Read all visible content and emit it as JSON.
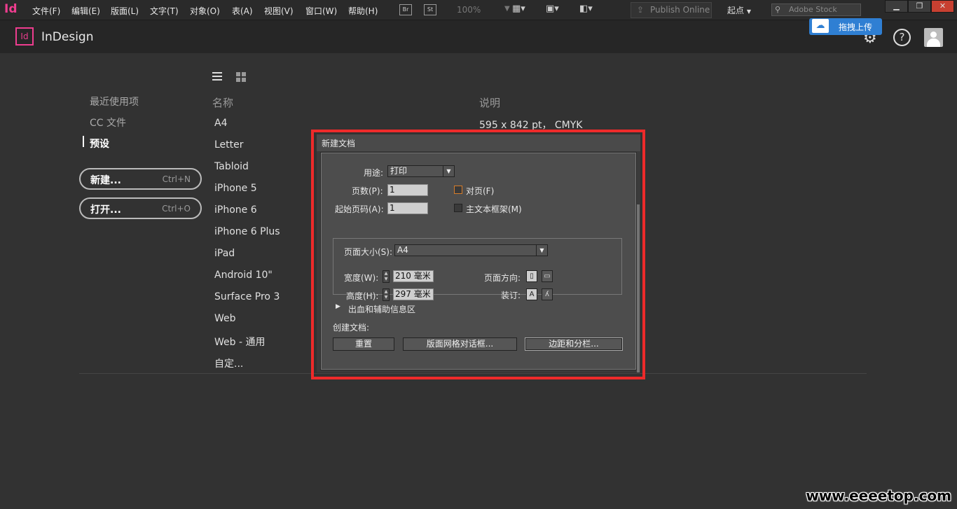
{
  "menubar": {
    "app_icon": "Id",
    "items": [
      "文件(F)",
      "编辑(E)",
      "版面(L)",
      "文字(T)",
      "对象(O)",
      "表(A)",
      "视图(V)",
      "窗口(W)",
      "帮助(H)"
    ],
    "bridge_label": "Br",
    "stock_label": "St",
    "zoom": "100%",
    "publish_online": "Publish Online",
    "workspace": "起点",
    "stock_search_placeholder": "Adobe Stock"
  },
  "header": {
    "logo_text": "Id",
    "app_name": "InDesign",
    "upload_badge": "拖拽上传"
  },
  "nav": {
    "recent": "最近使用项",
    "cc_files": "CC 文件",
    "presets": "预设"
  },
  "actions": {
    "new_label": "新建...",
    "new_shortcut": "Ctrl+N",
    "open_label": "打开...",
    "open_shortcut": "Ctrl+O"
  },
  "list": {
    "name_header": "名称",
    "desc_header": "说明",
    "first_desc": "595 x 842 pt， CMYK",
    "presets": [
      "A4",
      "Letter",
      "Tabloid",
      "iPhone 5",
      "iPhone 6",
      "iPhone 6 Plus",
      "iPad",
      "Android 10\"",
      "Surface Pro 3",
      "Web",
      "Web - 通用",
      "自定..."
    ]
  },
  "dialog": {
    "title": "新建文档",
    "intent_label": "用途:",
    "intent_value": "打印",
    "pages_label": "页数(P):",
    "pages_value": "1",
    "facing_label": "对页(F)",
    "start_label": "起始页码(A):",
    "start_value": "1",
    "primary_frame_label": "主文本框架(M)",
    "page_size_label": "页面大小(S):",
    "page_size_value": "A4",
    "width_label": "宽度(W):",
    "width_value": "210 毫米",
    "height_label": "高度(H):",
    "height_value": "297 毫米",
    "orientation_label": "页面方向:",
    "binding_label": "装订:",
    "bleed_label": "出血和辅助信息区",
    "create_label": "创建文档:",
    "reset_button": "重置",
    "layout_grid_button": "版面网格对话框...",
    "margins_button": "边距和分栏..."
  },
  "watermark": "www.eeeetop.com"
}
